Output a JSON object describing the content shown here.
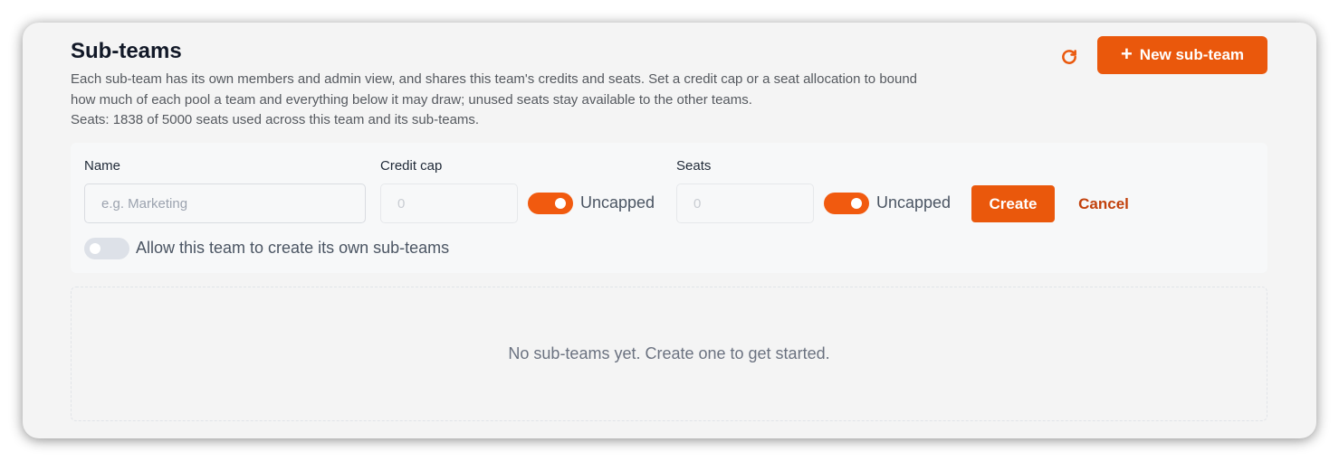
{
  "header": {
    "title": "Sub-teams",
    "description_line1": "Each sub-team has its own members and admin view, and shares this team's credits and seats. Set a credit cap or a seat allocation to bound",
    "description_line2": "how much of each pool a team and everything below it may draw; unused seats stay available to the other teams.",
    "seats_summary": "Seats: 1838 of 5000 seats used across this team and its sub-teams.",
    "refresh_icon": "refresh-icon",
    "new_button_label": "New sub-team",
    "new_button_icon": "plus-icon"
  },
  "form": {
    "name_label": "Name",
    "name_placeholder": "e.g. Marketing",
    "name_value": "",
    "credit_cap_label": "Credit cap",
    "credit_cap_placeholder": "0",
    "credit_uncapped_label": "Uncapped",
    "credit_uncapped_on": true,
    "seats_label": "Seats",
    "seats_placeholder": "0",
    "seats_uncapped_label": "Uncapped",
    "seats_uncapped_on": true,
    "create_label": "Create",
    "cancel_label": "Cancel",
    "allow_subteams_label": "Allow this team to create its own sub-teams",
    "allow_subteams_on": false
  },
  "empty_state": {
    "message": "No sub-teams yet. Create one to get started."
  },
  "colors": {
    "accent": "#ea580c",
    "cancel_text": "#c2410c",
    "toggle_off": "#dde1e8"
  }
}
